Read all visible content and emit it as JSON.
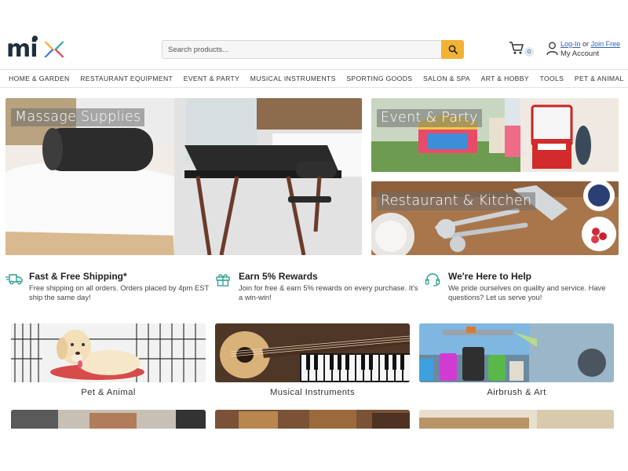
{
  "logo": {
    "text": "mix"
  },
  "search": {
    "placeholder": "Search products..."
  },
  "cart": {
    "count": "0"
  },
  "account": {
    "login": "Log-In",
    "or": "or",
    "join": "Join Free",
    "my_account": "My Account"
  },
  "nav": [
    "HOME & GARDEN",
    "RESTAURANT EQUIPMENT",
    "EVENT & PARTY",
    "MUSICAL INSTRUMENTS",
    "SPORTING GOODS",
    "SALON & SPA",
    "ART & HOBBY",
    "TOOLS",
    "PET & ANIMAL"
  ],
  "hero": {
    "massage": "Massage Supplies",
    "event": "Event & Party",
    "restaurant": "Restaurant & Kitchen"
  },
  "features": [
    {
      "title": "Fast & Free Shipping*",
      "text": "Free shipping on all orders. Orders placed by 4pm EST ship the same day!"
    },
    {
      "title": "Earn 5% Rewards",
      "text": "Join for free & earn 5% rewards on every purchase. It's a win-win!"
    },
    {
      "title": "We're Here to Help",
      "text": "We pride ourselves on quality and service. Have questions? Let us serve you!"
    }
  ],
  "categories": [
    "Pet & Animal",
    "Musical Instruments",
    "Airbrush & Art"
  ],
  "colors": {
    "accent": "#f2b233",
    "link": "#2f64b8",
    "feature_icon": "#2a9d8f"
  }
}
